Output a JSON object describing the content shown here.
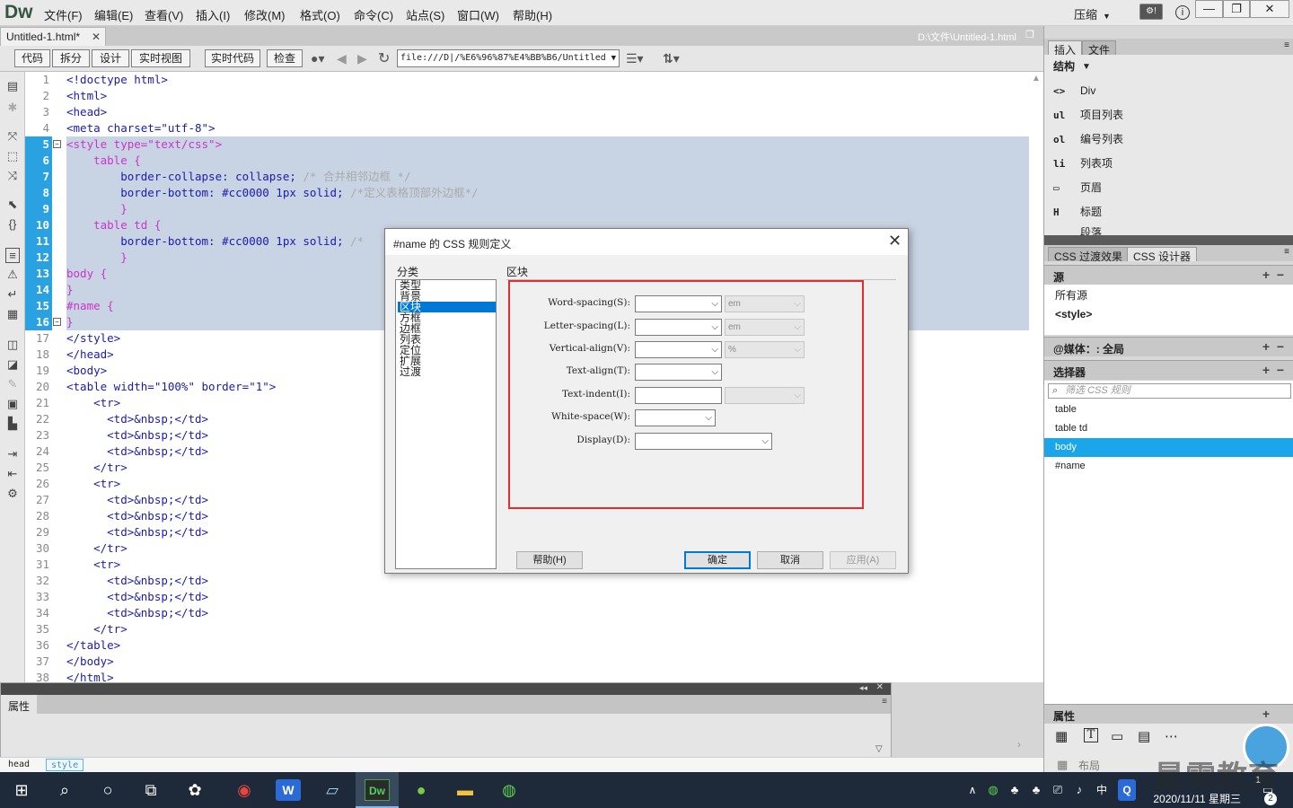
{
  "app": {
    "logo": "Dw",
    "menus": [
      "文件(F)",
      "编辑(E)",
      "查看(V)",
      "插入(I)",
      "修改(M)",
      "格式(O)",
      "命令(C)",
      "站点(S)",
      "窗口(W)",
      "帮助(H)"
    ],
    "compress": "压缩",
    "window_buttons": [
      "—",
      "❐",
      "✕"
    ]
  },
  "document": {
    "tab_label": "Untitled-1.html*",
    "path": "D:\\文件\\Untitled-1.html"
  },
  "toolbar": {
    "view_buttons": [
      "代码",
      "拆分",
      "设计",
      "实时视图"
    ],
    "live_code": "实时代码",
    "inspect": "检查",
    "url": "file:///D|/%E6%96%87%E4%BB%B6/Untitled"
  },
  "code": {
    "line_numbers": [
      "1",
      "2",
      "3",
      "4",
      "5",
      "6",
      "7",
      "8",
      "9",
      "10",
      "11",
      "12",
      "13",
      "14",
      "15",
      "16",
      "17",
      "18",
      "19",
      "20",
      "21",
      "22",
      "23",
      "24",
      "25",
      "26",
      "27",
      "28",
      "29",
      "30",
      "31",
      "32",
      "33",
      "34",
      "35",
      "36",
      "37",
      "38"
    ],
    "lines": {
      "l1": "<!doctype html>",
      "l2": "<html>",
      "l3": "<head>",
      "l4": "<meta charset=\"utf-8\">",
      "l5": "<style type=\"text/css\">",
      "l6": "    table {",
      "l7a": "        border-collapse: collapse;",
      "l7b": " /* 合并相邻边框 */",
      "l8a": "        border-bottom: #cc0000 1px solid;",
      "l8b": " /*定义表格顶部外边框*/",
      "l9": "        }",
      "l10": "    table td {",
      "l11a": "        border-bottom: #cc0000 1px solid;",
      "l11b": " /*",
      "l12": "        }",
      "l13": "body {",
      "l14": "}",
      "l15": "#name {",
      "l16": "}",
      "l17": "</style>",
      "l18": "</head>",
      "l19": "<body>",
      "l20": "<table width=\"100%\" border=\"1\">",
      "l_tr_open": "    <tr>",
      "l_td": "      <td>&nbsp;</td>",
      "l_tr_close": "    </tr>",
      "l36": "</table>",
      "l37": "</body>",
      "l38": "</html>"
    }
  },
  "properties": {
    "title": "属性"
  },
  "statusbar": {
    "crumbs": [
      "head",
      "style"
    ]
  },
  "right_panel": {
    "insert_tab": "插入",
    "files_tab": "文件",
    "category": "结构",
    "insert_items": [
      {
        "icon": "<>",
        "label": "Div"
      },
      {
        "icon": "ul",
        "label": "项目列表"
      },
      {
        "icon": "ol",
        "label": "编号列表"
      },
      {
        "icon": "li",
        "label": "列表项"
      },
      {
        "icon": "▭",
        "label": "页眉"
      },
      {
        "icon": "H",
        "label": "标题"
      },
      {
        "icon": "",
        "label": "段落"
      }
    ],
    "css_transitions_tab": "CSS 过渡效果",
    "css_designer_tab": "CSS 设计器",
    "sources_header": "源",
    "sources": [
      "所有源",
      "<style>"
    ],
    "media_header": "@媒体：: 全局",
    "selectors_header": "选择器",
    "filter_placeholder": "筛选 CSS 规则",
    "selectors": [
      "table",
      "table td",
      "body",
      "#name"
    ],
    "selected_selector": "body",
    "properties_header": "属性",
    "layout_label": "布局"
  },
  "dialog": {
    "title": "#name 的 CSS 规则定义",
    "category_label": "分类",
    "categories": [
      "类型",
      "背景",
      "区块",
      "方框",
      "边框",
      "列表",
      "定位",
      "扩展",
      "过渡"
    ],
    "selected_category": "区块",
    "section_label": "区块",
    "fields": {
      "word_spacing": {
        "label": "Word-spacing(S):",
        "unit": "em"
      },
      "letter_spacing": {
        "label": "Letter-spacing(L):",
        "unit": "em"
      },
      "vertical_align": {
        "label": "Vertical-align(V):",
        "unit": "%"
      },
      "text_align": {
        "label": "Text-align(T):"
      },
      "text_indent": {
        "label": "Text-indent(I):"
      },
      "white_space": {
        "label": "White-space(W):"
      },
      "display": {
        "label": "Display(D):"
      }
    },
    "buttons": {
      "help": "帮助(H)",
      "ok": "确定",
      "cancel": "取消",
      "apply": "应用(A)"
    },
    "highlight_color": "#e52d2d"
  },
  "taskbar": {
    "time": "1",
    "date": "2020/11/11 星期三",
    "notifications": "2"
  },
  "watermark": "最需教育",
  "colors": {
    "selection_blue": "#2aa1e0",
    "code_selection": "#c8d4e3",
    "css_pink": "#cc33cc",
    "tag_blue": "#1b1bb0",
    "selector_highlight": "#1aa6e8"
  }
}
